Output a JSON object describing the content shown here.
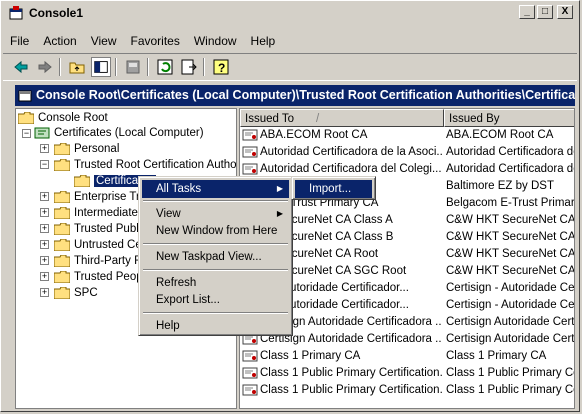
{
  "window": {
    "title": "Console1"
  },
  "title_buttons": {
    "minimize": "_",
    "maximize": "□",
    "close": "X"
  },
  "menubar": [
    "File",
    "Action",
    "View",
    "Favorites",
    "Window",
    "Help"
  ],
  "path": "Console Root\\Certificates (Local Computer)\\Trusted Root Certification Authorities\\Certificates",
  "tree": {
    "root": "Console Root",
    "certificates": "Certificates (Local Computer)",
    "items": [
      "Personal",
      "Trusted Root Certification Autho",
      "Certificates",
      "Enterprise Tr",
      "Intermediate",
      "Trusted Publ",
      "Untrusted Ce",
      "Third-Party R",
      "Trusted Peop",
      "SPC"
    ]
  },
  "list": {
    "columns": [
      "Issued To",
      "Issued By"
    ],
    "sort_indicator": "/",
    "rows": [
      [
        "ABA.ECOM Root CA",
        "ABA.ECOM Root CA"
      ],
      [
        "Autoridad Certificadora de la Asoci...",
        "Autoridad Certificadora de"
      ],
      [
        "Autoridad Certificadora del Colegi...",
        "Autoridad Certificadora de"
      ],
      [
        "",
        "Baltimore EZ by DST"
      ],
      [
        "om E-Trust Primary CA",
        "Belgacom E-Trust Primary C"
      ],
      [
        "KT SecureNet CA Class A",
        "C&W HKT SecureNet CA Cl"
      ],
      [
        "KT SecureNet CA Class B",
        "C&W HKT SecureNet CA Cl"
      ],
      [
        "KT SecureNet CA Root",
        "C&W HKT SecureNet CA Ro"
      ],
      [
        "KT SecureNet CA SGC Root",
        "C&W HKT SecureNet CA SG"
      ],
      [
        "gn - Autoridade Certificador...",
        "Certisign - Autoridade Cert"
      ],
      [
        "gn - Autoridade Certificador...",
        "Certisign - Autoridade Cert"
      ],
      [
        "Certisign Autoridade Certificadora ...",
        "Certisign Autoridade Certif"
      ],
      [
        "Certisign Autoridade Certificadora ...",
        "Certisign Autoridade Certif"
      ],
      [
        "Class 1 Primary CA",
        "Class 1 Primary CA"
      ],
      [
        "Class 1 Public Primary Certification...",
        "Class 1 Public Primary Cert"
      ],
      [
        "Class 1 Public Primary Certification...",
        "Class 1 Public Primary Cert"
      ]
    ]
  },
  "context_menu": {
    "items": [
      "All Tasks",
      "View",
      "New Window from Here",
      "New Taskpad View...",
      "Refresh",
      "Export List...",
      "Help"
    ]
  },
  "submenu": {
    "items": [
      "Import..."
    ]
  }
}
